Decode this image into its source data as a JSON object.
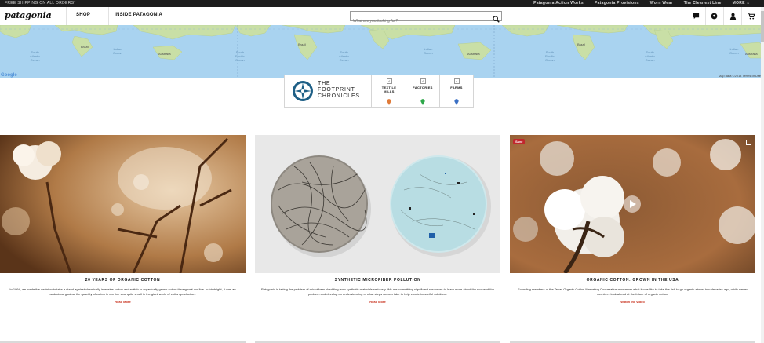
{
  "topbar": {
    "promo": "FREE SHIPPING ON ALL ORDERS*",
    "links": [
      "Patagonia Action Works",
      "Patagonia Provisions",
      "Worn Wear",
      "The Cleanest Line"
    ],
    "more": "MORE"
  },
  "nav": {
    "logo": "patagonia",
    "shop": "SHOP",
    "inside": "INSIDE PATAGONIA",
    "search_placeholder": "What are you looking for?"
  },
  "map": {
    "google": "Google",
    "footer": "Map data ©2018   Terms of Use",
    "oceans": [
      {
        "label": "South\nAtlantic\nOcean"
      },
      {
        "label": "Indian\nOcean"
      },
      {
        "label": "South\nPacific\nOcean"
      },
      {
        "label": "South\nAtlantic\nOcean"
      },
      {
        "label": "Indian\nOcean"
      },
      {
        "label": "South\nPacific\nOcean"
      },
      {
        "label": "South\nAtlantic\nOcean"
      },
      {
        "label": "Indian\nOcean"
      }
    ],
    "countries": [
      "Brazil",
      "Australia",
      "Brazil",
      "Australia",
      "Brazil",
      "Australia"
    ]
  },
  "legend": {
    "title_line1": "THE",
    "title_line2": "FOOTPRINT",
    "title_line3": "CHRONICLES",
    "items": [
      {
        "label": "TEXTILE\nMILLS",
        "color": "#e07b39"
      },
      {
        "label": "FACTORIES",
        "color": "#2ea84a"
      },
      {
        "label": "FARMS",
        "color": "#3a6fc4"
      }
    ]
  },
  "cards": [
    {
      "title": "20 YEARS OF ORGANIC COTTON",
      "desc": "In 1994, we made the decision to take a stand against chemically intensive cotton and switch to organically grown cotton throughout our line. In hindsight, it was an audacious goal as the quantity of cotton in our line was quite small in the giant world of cotton production.",
      "link": "Read More"
    },
    {
      "title": "SYNTHETIC MICROFIBER POLLUTION",
      "desc": "Patagonia is taking the problem of microfibers shedding from synthetic materials seriously. We are committing significant resources to learn more about the scope of the problem and develop an understanding of what steps we can take to help create impactful solutions.",
      "link": "Read More"
    },
    {
      "title": "ORGANIC COTTON: GROWN IN THE USA",
      "desc": "Founding members of the Texas Organic Cotton Marketing Cooperative remember what it was like to take the risk to go organic almost two decades ago, while newer members look ahead at the future of organic cotton.",
      "link": "Watch the video",
      "save": "Save"
    }
  ]
}
